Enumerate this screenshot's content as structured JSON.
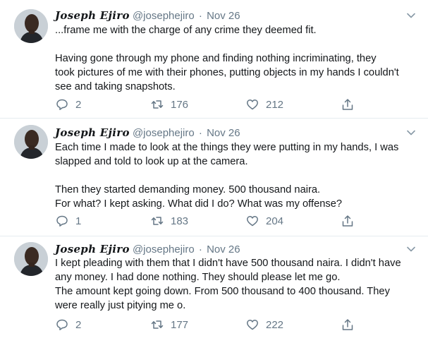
{
  "tweets": [
    {
      "display_name": "Joseph Ejiro",
      "handle": "@josephejiro",
      "separator": "·",
      "date": "Nov 26",
      "lines": [
        "...frame me with the charge of any crime they deemed fit.",
        "",
        "Having gone through my phone and finding nothing incriminating, they",
        "took pictures of me with their phones, putting objects in my hands I couldn't",
        "see and taking snapshots."
      ],
      "replies": "2",
      "retweets": "176",
      "likes": "212"
    },
    {
      "display_name": "Joseph Ejiro",
      "handle": "@josephejiro",
      "separator": "·",
      "date": "Nov 26",
      "lines": [
        "Each time I made to look at the things they were putting in my hands, I was",
        "slapped and told to look up at the camera.",
        "",
        "Then they started demanding money. 500 thousand naira.",
        "For what? I kept asking. What did I do? What was my offense?"
      ],
      "replies": "1",
      "retweets": "183",
      "likes": "204"
    },
    {
      "display_name": "Joseph Ejiro",
      "handle": "@josephejiro",
      "separator": "·",
      "date": "Nov 26",
      "lines": [
        "I kept pleading with them that I didn't have 500 thousand naira. I didn't have",
        "any money. I had done nothing. They should please let me go.",
        "The amount kept going down. From 500 thousand to 400 thousand. They",
        "were really just pitying me o."
      ],
      "replies": "2",
      "retweets": "177",
      "likes": "222"
    }
  ],
  "icons": {
    "reply": "reply-icon",
    "retweet": "retweet-icon",
    "like": "heart-icon",
    "share": "share-icon",
    "caret": "chevron-down-icon"
  },
  "colors": {
    "text": "#14171a",
    "muted": "#657786",
    "divider": "#e6ecf0"
  }
}
